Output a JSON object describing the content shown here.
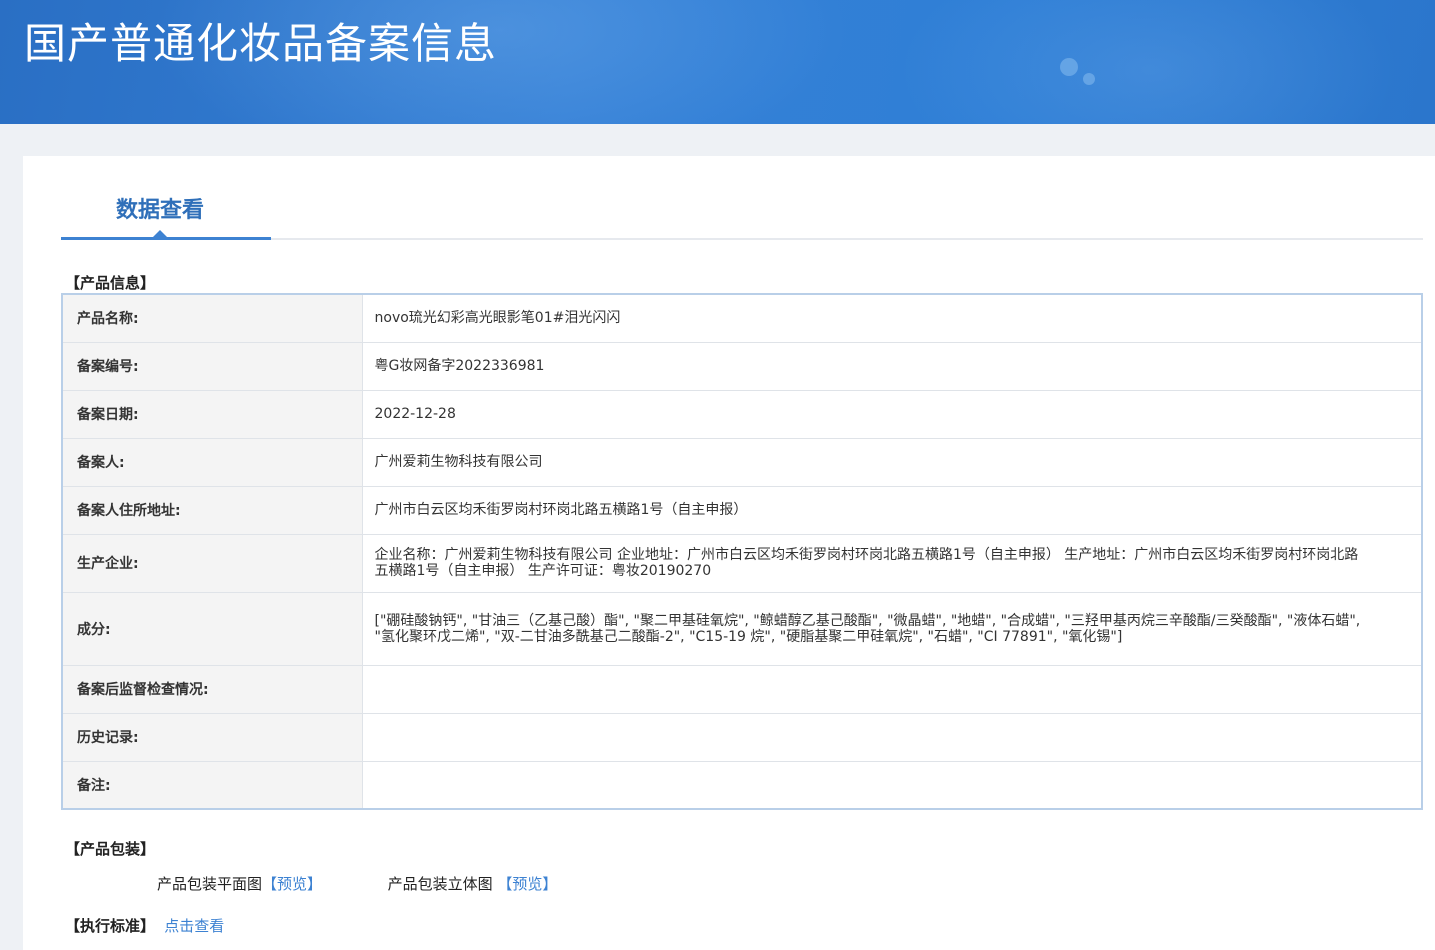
{
  "banner": {
    "title": "国产普通化妆品备案信息"
  },
  "tab": {
    "label": "数据查看"
  },
  "product_section": {
    "title": "【产品信息】",
    "rows": [
      {
        "key": "产品名称:",
        "value": "novo琉光幻彩高光眼影笔01#泪光闪闪"
      },
      {
        "key": "备案编号:",
        "value": "粤G妆网备字2022336981"
      },
      {
        "key": "备案日期:",
        "value": "2022-12-28"
      },
      {
        "key": "备案人:",
        "value": "广州爱莉生物科技有限公司"
      },
      {
        "key": "备案人住所地址:",
        "value": "广州市白云区均禾街罗岗村环岗北路五横路1号（自主申报）"
      },
      {
        "key": "生产企业:",
        "value": "企业名称：广州爱莉生物科技有限公司 企业地址：广州市白云区均禾街罗岗村环岗北路五横路1号（自主申报） 生产地址：广州市白云区均禾街罗岗村环岗北路五横路1号（自主申报） 生产许可证：粤妆20190270"
      },
      {
        "key": "成分:",
        "value": "[\"硼硅酸钠钙\", \"甘油三（乙基己酸）酯\", \"聚二甲基硅氧烷\", \"鲸蜡醇乙基己酸酯\", \"微晶蜡\", \"地蜡\", \"合成蜡\", \"三羟甲基丙烷三辛酸酯/三癸酸酯\", \"液体石蜡\", \"氢化聚环戊二烯\", \"双-二甘油多酰基己二酸酯-2\", \"C15-19 烷\", \"硬脂基聚二甲硅氧烷\", \"石蜡\", \"CI 77891\", \"氧化锡\"]"
      },
      {
        "key": "备案后监督检查情况:",
        "value": ""
      },
      {
        "key": "历史记录:",
        "value": ""
      },
      {
        "key": "备注:",
        "value": ""
      }
    ]
  },
  "packaging_section": {
    "title": "【产品包装】",
    "flat_label": "产品包装平面图",
    "flat_link": "【预览】",
    "solid_label": "产品包装立体图",
    "solid_link": "【预览】"
  },
  "standard_section": {
    "title": "【执行标准】",
    "link": "点击查看"
  },
  "colors": {
    "banner": "#3580d6",
    "accent": "#3d82d2",
    "link": "#3d82d2"
  }
}
